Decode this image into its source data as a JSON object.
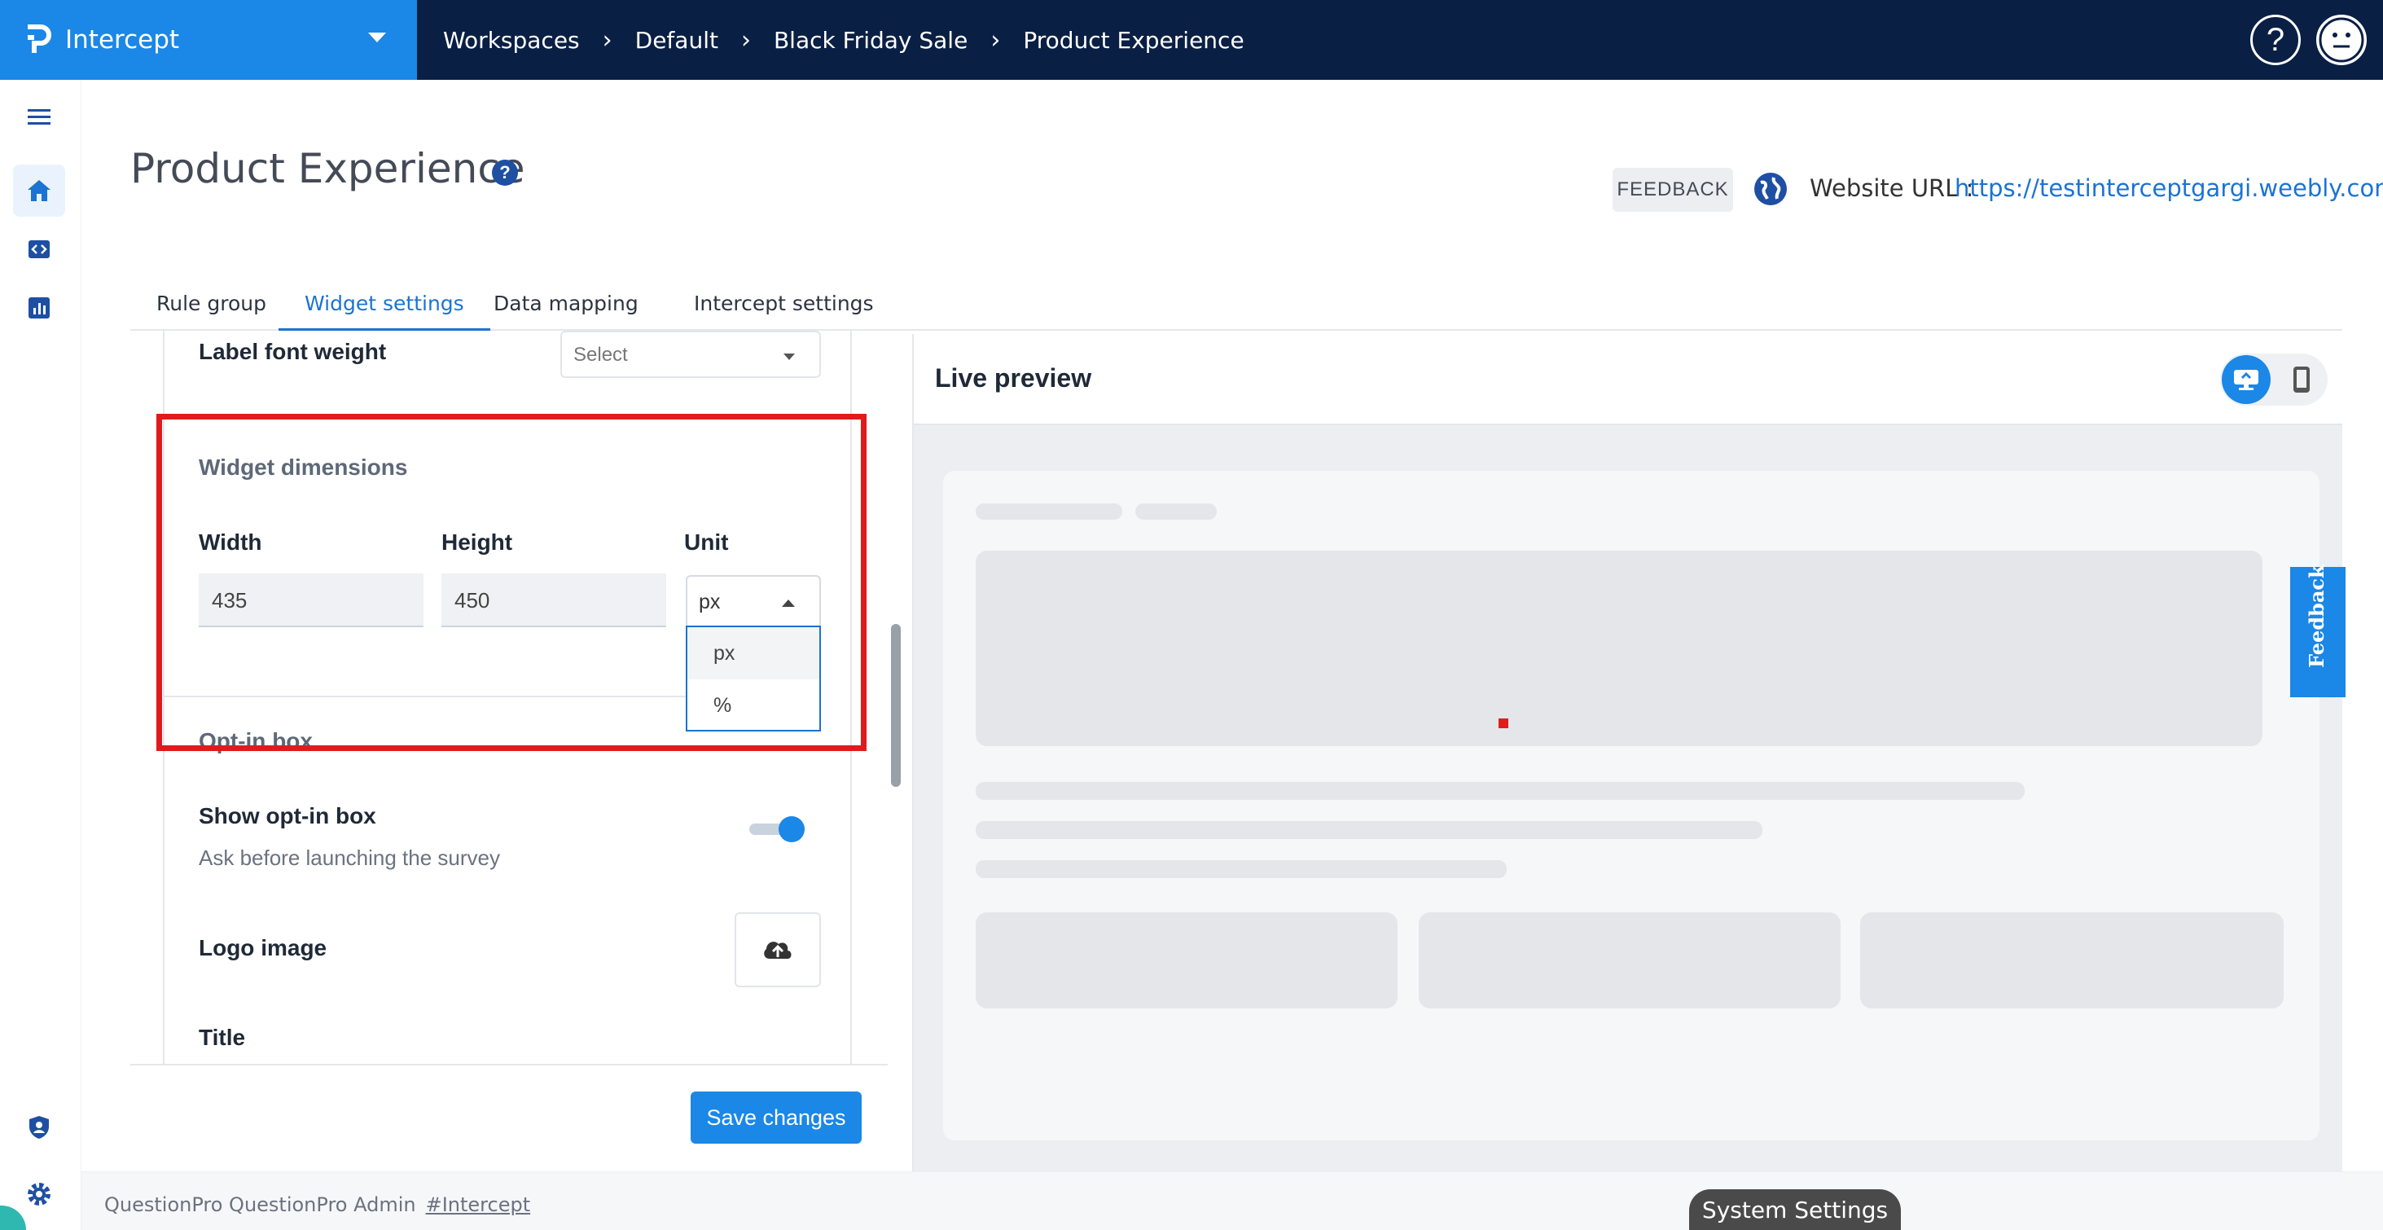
{
  "app": {
    "name": "Intercept"
  },
  "breadcrumbs": [
    "Workspaces",
    "Default",
    "Black Friday Sale",
    "Product Experience"
  ],
  "header": {
    "title": "Product Experience",
    "feedback_label": "FEEDBACK",
    "website_label": "Website URL :",
    "website_url": "https://testinterceptgargi.weebly.com"
  },
  "tabs": [
    {
      "label": "Rule group",
      "active": false
    },
    {
      "label": "Widget settings",
      "active": true
    },
    {
      "label": "Data mapping",
      "active": false
    },
    {
      "label": "Intercept settings",
      "active": false
    }
  ],
  "settings": {
    "label_font_weight": {
      "label": "Label font weight",
      "placeholder": "Select"
    },
    "widget_dimensions": {
      "title": "Widget dimensions",
      "width_label": "Width",
      "height_label": "Height",
      "unit_label": "Unit",
      "width_value": "435",
      "height_value": "450",
      "unit_value": "px",
      "unit_options": [
        "px",
        "%"
      ]
    },
    "opt_in": {
      "section_title": "Opt-in box",
      "show_label": "Show opt-in box",
      "show_description": "Ask before launching the survey",
      "show_enabled": true,
      "logo_label": "Logo image",
      "title_label": "Title"
    },
    "save_label": "Save changes"
  },
  "preview": {
    "title": "Live preview",
    "feedback_tab": "Feedback",
    "device": "desktop"
  },
  "footer": {
    "text": "QuestionPro  QuestionPro Admin",
    "link": "#Intercept"
  },
  "system_settings_label": "System Settings",
  "colors": {
    "topbar": "#0a1f44",
    "brand": "#1b87e6",
    "accent": "#1b73d3",
    "highlight": "#e01b1b"
  },
  "icons": {
    "rail": [
      "menu-icon",
      "home-icon",
      "code-icon",
      "chart-icon",
      "shield-user-icon",
      "gear-icon"
    ],
    "header": [
      "help-icon",
      "avatar-icon",
      "globe-icon"
    ]
  }
}
